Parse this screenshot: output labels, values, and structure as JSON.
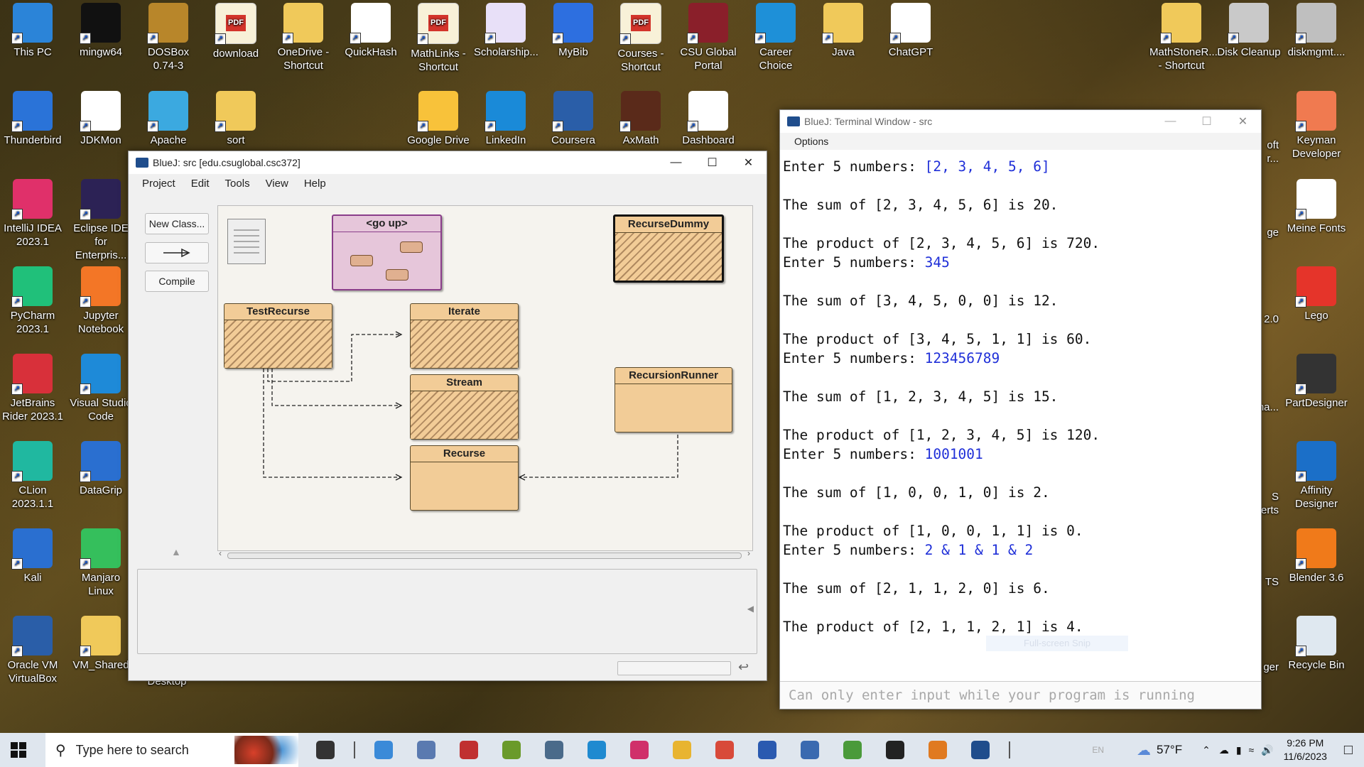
{
  "desktop": {
    "row1": [
      {
        "label": "This PC",
        "icon": "this-pc-icon",
        "color": "#2b84d8"
      },
      {
        "label": "mingw64",
        "icon": "terminal-icon",
        "color": "#111111"
      },
      {
        "label": "DOSBox\n0.74-3",
        "icon": "dosbox-icon",
        "color": "#b8862a"
      },
      {
        "label": "download",
        "icon": "pdf-icon",
        "color": "#f8f1d8"
      },
      {
        "label": "OneDrive -\nShortcut",
        "icon": "folder-icon",
        "color": "#f0c95a"
      },
      {
        "label": "QuickHash",
        "icon": "quickhash-icon",
        "color": "#ffffff"
      },
      {
        "label": "MathLinks -\nShortcut",
        "icon": "pdf-icon",
        "color": "#f8f1d8"
      },
      {
        "label": "Scholarship...",
        "icon": "certificate-icon",
        "color": "#e8e0f8"
      },
      {
        "label": "MyBib",
        "icon": "bookmark-icon",
        "color": "#2d6fe0"
      },
      {
        "label": "Courses -\nShortcut",
        "icon": "pdf-icon",
        "color": "#f8f1d8"
      },
      {
        "label": "CSU Global\nPortal",
        "icon": "csu-seal-icon",
        "color": "#8a1f2a"
      },
      {
        "label": "Career\nChoice",
        "icon": "career-icon",
        "color": "#1e90d8"
      },
      {
        "label": "Java",
        "icon": "folder-icon",
        "color": "#f0c95a"
      },
      {
        "label": "ChatGPT",
        "icon": "chatgpt-icon",
        "color": "#ffffff"
      }
    ],
    "row2": [
      {
        "label": "Thunderbird",
        "icon": "thunderbird-icon",
        "color": "#2a73d8"
      },
      {
        "label": "JDKMon",
        "icon": "jdkmon-icon",
        "color": "#ffffff"
      },
      {
        "label": "Apache",
        "icon": "apache-netbeans-icon",
        "color": "#3ba9e0"
      },
      {
        "label": "sort",
        "icon": "folder-icon",
        "color": "#f0c95a"
      },
      {
        "label": "Google Drive",
        "icon": "google-drive-icon",
        "color": "#f8c23a"
      },
      {
        "label": "LinkedIn",
        "icon": "linkedin-icon",
        "color": "#1a8ad8"
      },
      {
        "label": "Coursera",
        "icon": "coursera-icon",
        "color": "#2a5ea8"
      },
      {
        "label": "AxMath",
        "icon": "axmath-icon",
        "color": "#5a2a1a"
      },
      {
        "label": "Dashboard",
        "icon": "dashboard-icon",
        "color": "#ffffff"
      }
    ],
    "left_col": [
      {
        "label": "IntelliJ IDEA\n2023.1",
        "icon": "intellij-icon",
        "color": "#e0306a"
      },
      {
        "label": "PyCharm\n2023.1",
        "icon": "pycharm-icon",
        "color": "#20c07a"
      },
      {
        "label": "JetBrains\nRider 2023.1",
        "icon": "rider-icon",
        "color": "#d8303a"
      },
      {
        "label": "CLion\n2023.1.1",
        "icon": "clion-icon",
        "color": "#20b8a0"
      },
      {
        "label": "Kali",
        "icon": "kali-icon",
        "color": "#2a6fd0"
      },
      {
        "label": "Oracle VM\nVirtualBox",
        "icon": "virtualbox-icon",
        "color": "#2a5ea8"
      }
    ],
    "second_col": [
      {
        "label": "Eclipse IDE\nfor Enterpris...",
        "icon": "eclipse-icon",
        "color": "#2c2255"
      },
      {
        "label": "Jupyter\nNotebook",
        "icon": "jupyter-icon",
        "color": "#f37626"
      },
      {
        "label": "Visual Studio\nCode",
        "icon": "vscode-icon",
        "color": "#1e8ad8"
      },
      {
        "label": "DataGrip",
        "icon": "datagrip-icon",
        "color": "#2a6fd0"
      },
      {
        "label": "Manjaro\nLinux",
        "icon": "manjaro-icon",
        "color": "#35bf5c"
      },
      {
        "label": "VM_Shared",
        "icon": "folder-icon",
        "color": "#f0c95a"
      }
    ],
    "right_col": [
      {
        "label": "MathStoneR...\n- Shortcut",
        "icon": "folder-icon",
        "color": "#f0c95a"
      },
      {
        "label": "Disk Cleanup",
        "icon": "disk-cleanup-icon",
        "color": "#c9c9c9"
      },
      {
        "label": "diskmgmt....",
        "icon": "diskmgmt-icon",
        "color": "#bfbfbf"
      }
    ],
    "far_right_col": [
      {
        "label": "Keyman\nDeveloper",
        "icon": "keyman-icon",
        "color": "#f07a50"
      },
      {
        "label": "Meine Fonts",
        "icon": "meine-fonts-icon",
        "color": "#ffffff"
      },
      {
        "label": "Lego",
        "icon": "lego-icon",
        "color": "#e5342a"
      },
      {
        "label": "PartDesigner",
        "icon": "partdesigner-icon",
        "color": "#333333"
      },
      {
        "label": "Affinity\nDesigner",
        "icon": "affinity-designer-icon",
        "color": "#1b6fc8"
      },
      {
        "label": "Blender 3.6",
        "icon": "blender-icon",
        "color": "#f07a1a"
      },
      {
        "label": "Recycle Bin",
        "icon": "recycle-bin-icon",
        "color": "#dfe8f0"
      }
    ],
    "partial_labels": [
      "oft\nr...",
      "ge",
      "2.0",
      "na...",
      "S\nerts",
      "TS",
      "ger"
    ],
    "desktop_label": "Desktop"
  },
  "bluej": {
    "title": "BlueJ:  src  [edu.csuglobal.csc372]",
    "menu": [
      "Project",
      "Edit",
      "Tools",
      "View",
      "Help"
    ],
    "new_class_label": "New Class...",
    "compile_label": "Compile",
    "go_up_label": "<go up>",
    "classes": {
      "recurse_dummy": "RecurseDummy",
      "test_recurse": "TestRecurse",
      "iterate": "Iterate",
      "stream": "Stream",
      "recursion_runner": "RecursionRunner",
      "recurse": "Recurse"
    }
  },
  "terminal": {
    "title": "BlueJ: Terminal Window - src",
    "options_label": "Options",
    "lines": [
      {
        "text": "Enter 5 numbers: ",
        "input": "[2, 3, 4, 5, 6]"
      },
      {
        "text": "",
        "input": ""
      },
      {
        "text": "The sum of [2, 3, 4, 5, 6] is 20.",
        "input": ""
      },
      {
        "text": "",
        "input": ""
      },
      {
        "text": "The product of [2, 3, 4, 5, 6] is 720.",
        "input": ""
      },
      {
        "text": "Enter 5 numbers: ",
        "input": "345"
      },
      {
        "text": "",
        "input": ""
      },
      {
        "text": "The sum of [3, 4, 5, 0, 0] is 12.",
        "input": ""
      },
      {
        "text": "",
        "input": ""
      },
      {
        "text": "The product of [3, 4, 5, 1, 1] is 60.",
        "input": ""
      },
      {
        "text": "Enter 5 numbers: ",
        "input": "123456789"
      },
      {
        "text": "",
        "input": ""
      },
      {
        "text": "The sum of [1, 2, 3, 4, 5] is 15.",
        "input": ""
      },
      {
        "text": "",
        "input": ""
      },
      {
        "text": "The product of [1, 2, 3, 4, 5] is 120.",
        "input": ""
      },
      {
        "text": "Enter 5 numbers: ",
        "input": "1001001"
      },
      {
        "text": "",
        "input": ""
      },
      {
        "text": "The sum of [1, 0, 0, 1, 0] is 2.",
        "input": ""
      },
      {
        "text": "",
        "input": ""
      },
      {
        "text": "The product of [1, 0, 0, 1, 1] is 0.",
        "input": ""
      },
      {
        "text": "Enter 5 numbers: ",
        "input": "2 & 1 & 1 & 2"
      },
      {
        "text": "",
        "input": ""
      },
      {
        "text": "The sum of [2, 1, 1, 2, 0] is 6.",
        "input": ""
      },
      {
        "text": "",
        "input": ""
      },
      {
        "text": "The product of [2, 1, 1, 2, 1] is 4.",
        "input": ""
      }
    ],
    "input_placeholder": "Can only enter input while your program is running",
    "faint_overlay": "Full-screen Snip"
  },
  "taskbar": {
    "search_placeholder": "Type here to search",
    "weather": "57°F",
    "language": "EN",
    "time": "9:26 PM",
    "date": "11/6/2023"
  },
  "colors": {
    "class_fill": "#f2cc97",
    "package_fill": "#e6c6da",
    "package_border": "#8a3e8a",
    "input_blue": "#1f2fd8"
  }
}
